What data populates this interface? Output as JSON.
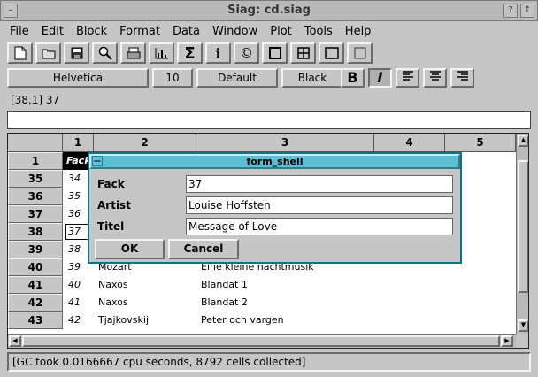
{
  "window": {
    "title": "Siag: cd.siag"
  },
  "menu": [
    "File",
    "Edit",
    "Block",
    "Format",
    "Data",
    "Window",
    "Plot",
    "Tools",
    "Help"
  ],
  "toolbar_icons": [
    "new-file-icon",
    "open-icon",
    "save-icon",
    "preview-icon",
    "print-icon",
    "chart-icon",
    "sum-icon",
    "info-icon",
    "copyright-icon",
    "border-box-icon",
    "grid-icon",
    "frame-icon",
    "blank-frame-icon"
  ],
  "format": {
    "font": "Helvetica",
    "size": "10",
    "style": "Default",
    "color": "Black",
    "bold": "B",
    "italic": "I"
  },
  "cellref": "[38,1] 37",
  "formula": "",
  "columns": [
    "1",
    "2",
    "3",
    "4",
    "5"
  ],
  "rows": [
    {
      "num": "1",
      "c1": "Fack",
      "c2": "",
      "c3": ""
    },
    {
      "num": "35",
      "c1": "34",
      "c2": "",
      "c3": ""
    },
    {
      "num": "36",
      "c1": "35",
      "c2": "",
      "c3": ""
    },
    {
      "num": "37",
      "c1": "36",
      "c2": "",
      "c3": ""
    },
    {
      "num": "38",
      "c1": "37",
      "c2": "",
      "c3": ""
    },
    {
      "num": "39",
      "c1": "38",
      "c2": "",
      "c3": ""
    },
    {
      "num": "40",
      "c1": "39",
      "c2": "Mozart",
      "c3": "Eine kleine nachtmusik"
    },
    {
      "num": "41",
      "c1": "40",
      "c2": "Naxos",
      "c3": "Blandat 1"
    },
    {
      "num": "42",
      "c1": "41",
      "c2": "Naxos",
      "c3": "Blandat 2"
    },
    {
      "num": "43",
      "c1": "42",
      "c2": "Tjajkovskij",
      "c3": "Peter och vargen"
    }
  ],
  "status": "[GC took 0.0166667 cpu seconds, 8792 cells collected]",
  "dialog": {
    "title": "form_shell",
    "fields": [
      {
        "label": "Fack",
        "value": "37"
      },
      {
        "label": "Artist",
        "value": "Louise Hoffsten"
      },
      {
        "label": "Titel",
        "value": "Message of Love"
      }
    ],
    "ok": "OK",
    "cancel": "Cancel"
  }
}
